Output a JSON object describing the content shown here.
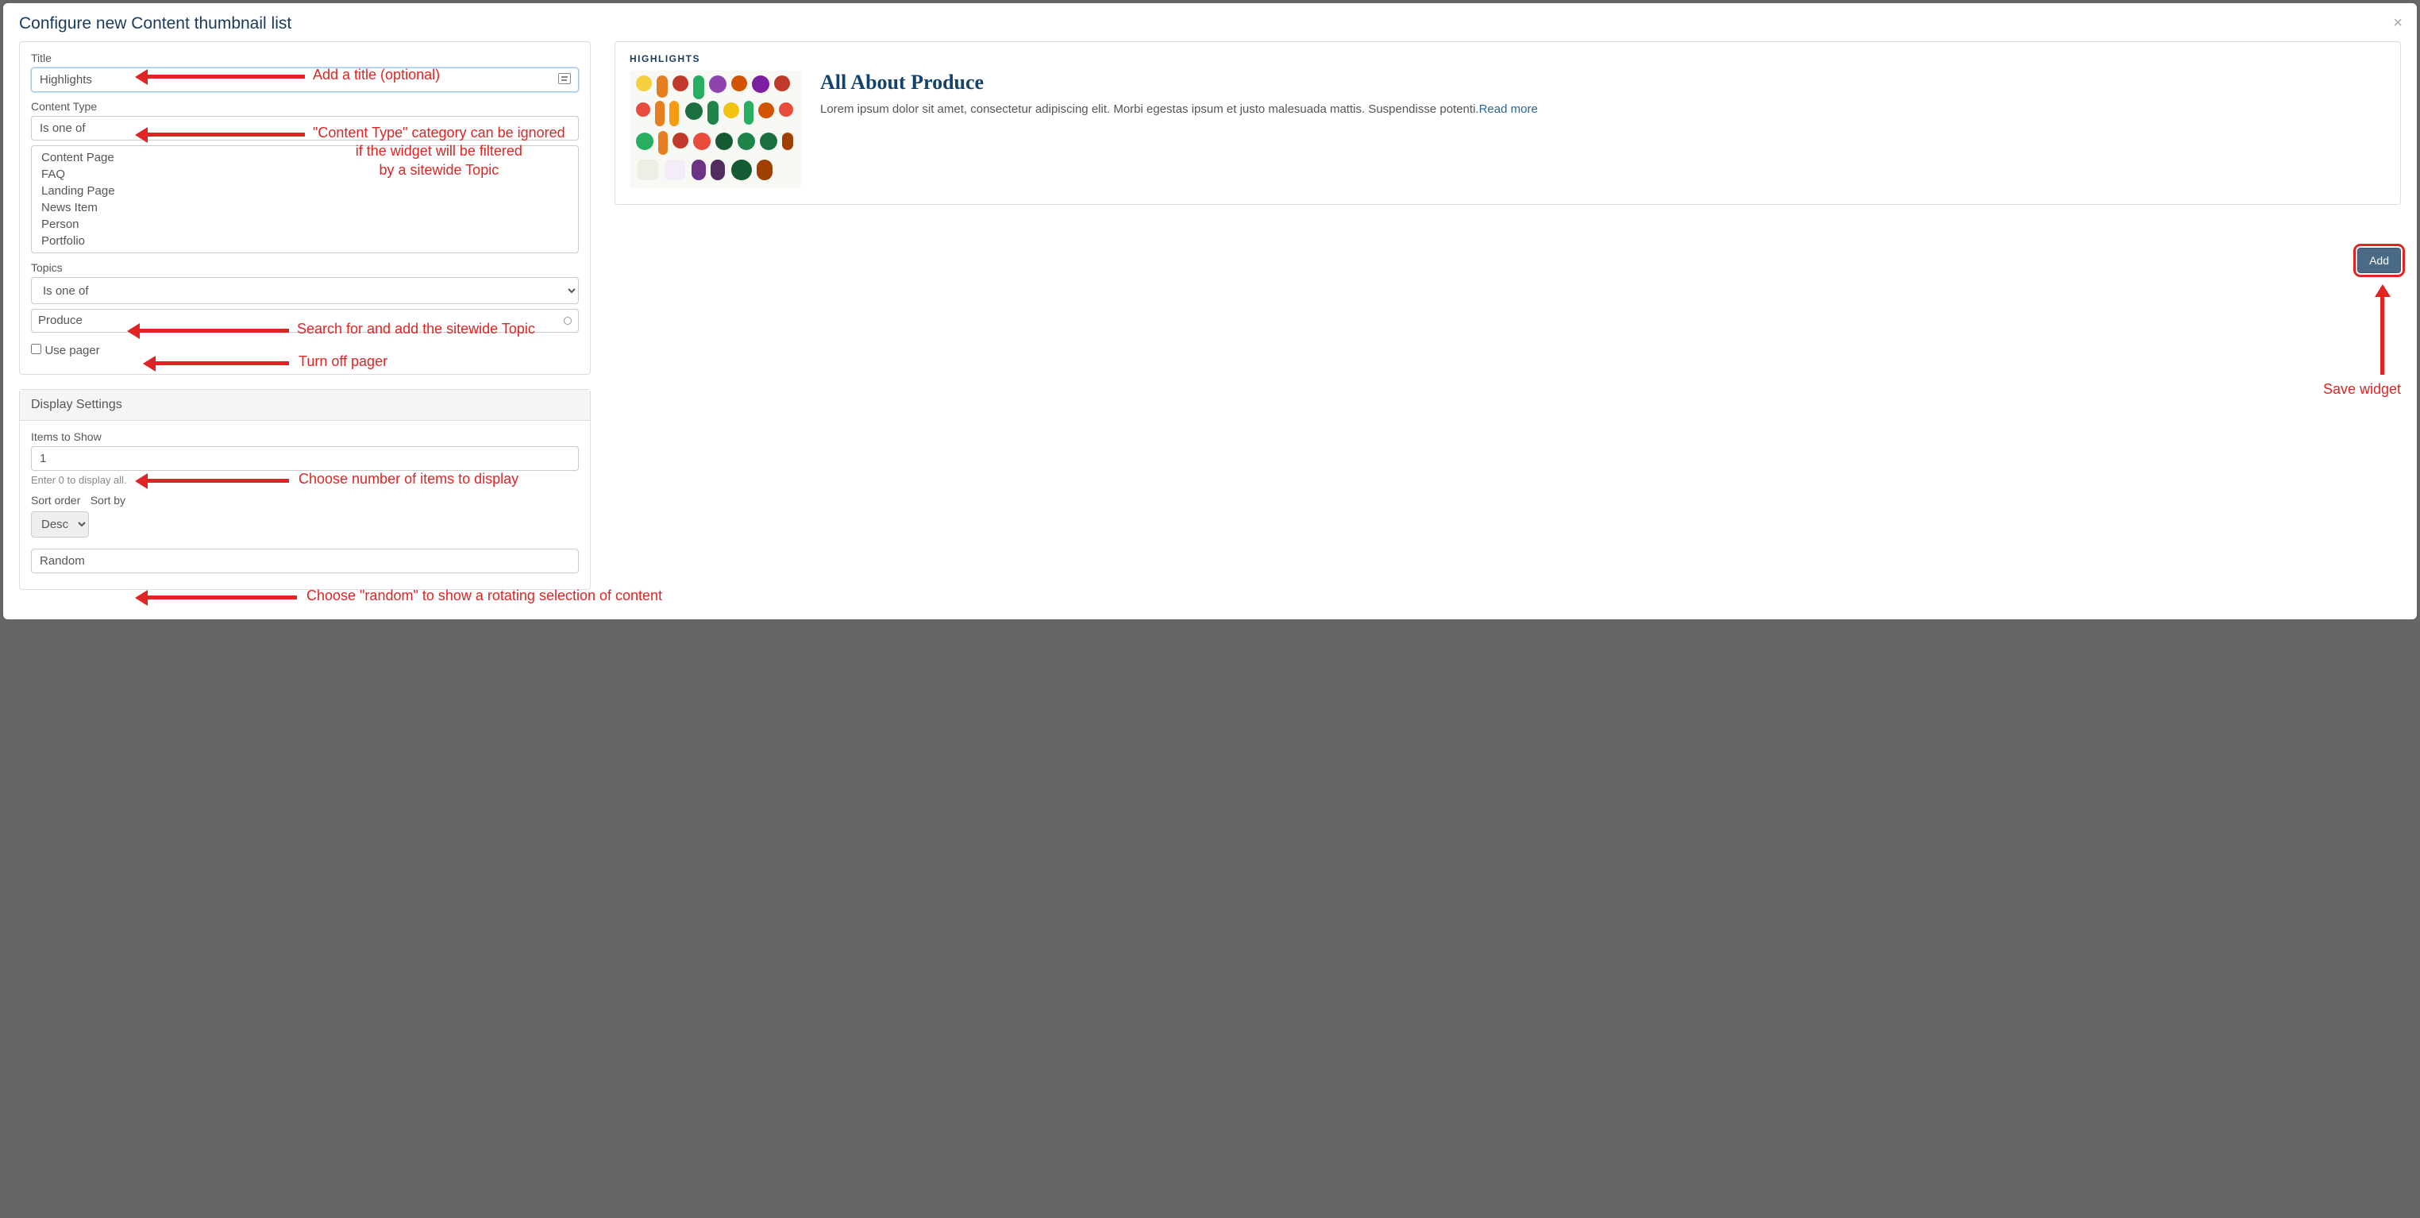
{
  "modal": {
    "title": "Configure new Content thumbnail list",
    "close": "×"
  },
  "form": {
    "title_label": "Title",
    "title_value": "Highlights",
    "content_type_label": "Content Type",
    "content_type_operator": "Is one of",
    "content_type_options": [
      "Content Page",
      "FAQ",
      "Landing Page",
      "News Item",
      "Person",
      "Portfolio"
    ],
    "topics_label": "Topics",
    "topics_operator": "Is one of",
    "topics_tag": "Produce",
    "use_pager_label": "Use pager"
  },
  "display": {
    "heading": "Display Settings",
    "items_label": "Items to Show",
    "items_value": "1",
    "items_help": "Enter 0 to display all.",
    "sort_order_label": "Sort order",
    "sort_by_label": "Sort by",
    "sort_order_value": "Desc",
    "sort_by_value": "Random"
  },
  "preview": {
    "eyebrow": "HIGHLIGHTS",
    "title": "All About Produce",
    "desc": "Lorem ipsum dolor sit amet, consectetur adipiscing elit. Morbi egestas ipsum et justo malesuada mattis. Suspendisse potenti.",
    "read_more": "Read more"
  },
  "actions": {
    "add": "Add"
  },
  "annotations": {
    "title": "Add a title (optional)",
    "content_type": "\"Content Type\" category can be ignored\nif the widget will be filtered\nby a sitewide Topic",
    "topic": "Search for and add the sitewide Topic",
    "pager": "Turn off pager",
    "items": "Choose number of items to display",
    "random": "Choose \"random\" to show a rotating selection of content",
    "save": "Save widget"
  }
}
